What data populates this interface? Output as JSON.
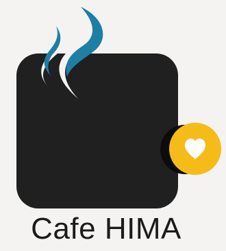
{
  "app": {
    "name": "Cafe HIMA",
    "icon": "coffee-cup-steam-icon",
    "badge_icon": "heart-icon",
    "colors": {
      "background": "#f4f3f2",
      "cup": "#202020",
      "steam": "#1d7fa4",
      "badge": "#f5bb19",
      "heart": "#ffffff"
    }
  }
}
